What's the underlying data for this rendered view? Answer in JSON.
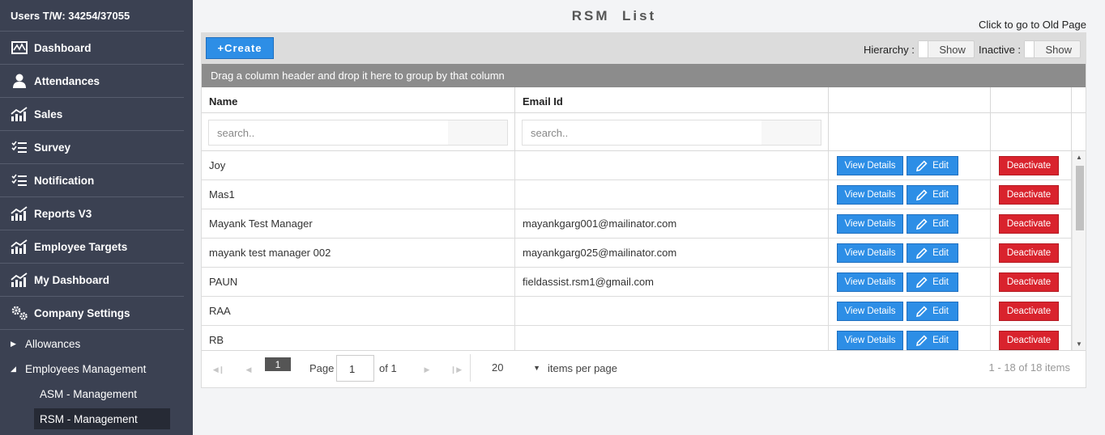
{
  "sidebar": {
    "users_tw": "Users T/W: 34254/37055",
    "items": [
      {
        "label": "Dashboard",
        "icon": "dashboard-icon"
      },
      {
        "label": "Attendances",
        "icon": "user-icon"
      },
      {
        "label": "Sales",
        "icon": "chart-icon"
      },
      {
        "label": "Survey",
        "icon": "checklist-icon"
      },
      {
        "label": "Notification",
        "icon": "checklist-icon"
      },
      {
        "label": "Reports V3",
        "icon": "chart-icon"
      },
      {
        "label": "Employee Targets",
        "icon": "chart-icon"
      },
      {
        "label": "My Dashboard",
        "icon": "chart-icon"
      },
      {
        "label": "Company Settings",
        "icon": "gears-icon"
      }
    ],
    "sub_items": [
      {
        "label": "Allowances",
        "expanded": false
      },
      {
        "label": "Employees Management",
        "expanded": true
      }
    ],
    "subsub_items": [
      {
        "label": "ASM - Management"
      },
      {
        "label": "RSM - Management"
      }
    ]
  },
  "page": {
    "title": "RSM  List",
    "old_page_link": "Click to go to Old Page"
  },
  "toolbar": {
    "create_label": "+Create",
    "hierarchy_label": "Hierarchy :",
    "hierarchy_toggle": "Show",
    "inactive_label": "Inactive :",
    "inactive_toggle": "Show"
  },
  "grid": {
    "group_hint": "Drag a column header and drop it here to group by that column",
    "columns": {
      "name": "Name",
      "email": "Email Id"
    },
    "filters": {
      "name_placeholder": "search..",
      "email_placeholder": "search.."
    },
    "rows": [
      {
        "name": "Joy",
        "email": ""
      },
      {
        "name": "Mas1",
        "email": ""
      },
      {
        "name": "Mayank Test Manager",
        "email": "mayankgarg001@mailinator.com"
      },
      {
        "name": "mayank test manager 002",
        "email": "mayankgarg025@mailinator.com"
      },
      {
        "name": "PAUN",
        "email": "fieldassist.rsm1@gmail.com"
      },
      {
        "name": "RAA",
        "email": ""
      },
      {
        "name": "RB",
        "email": ""
      }
    ],
    "actions": {
      "view": "View Details",
      "edit": "Edit",
      "deactivate": "Deactivate"
    }
  },
  "pager": {
    "current_page": "1",
    "page_label": "Page",
    "page_input": "1",
    "of_label": "of 1",
    "page_size": "20",
    "per_page_label": "items per page",
    "info": "1 - 18 of 18 items"
  },
  "colors": {
    "sidebar_bg": "#3b4152",
    "primary": "#2d8ee6",
    "danger": "#d9232d",
    "group_bar": "#8c8c8c"
  }
}
